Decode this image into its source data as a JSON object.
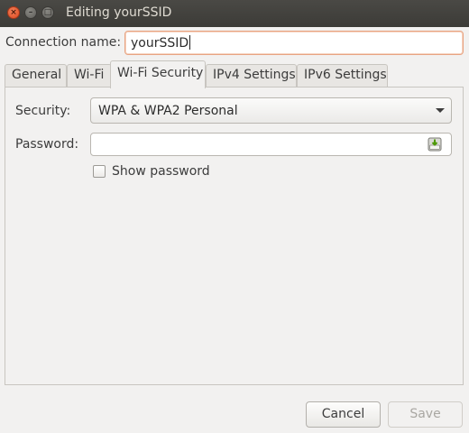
{
  "window": {
    "title": "Editing yourSSID",
    "close_glyph": "×",
    "min_glyph": "–",
    "max_glyph": "□"
  },
  "connection": {
    "label": "Connection name:",
    "value": "yourSSID"
  },
  "tabs": [
    {
      "label": "General",
      "active": false
    },
    {
      "label": "Wi-Fi",
      "active": false
    },
    {
      "label": "Wi-Fi Security",
      "active": true
    },
    {
      "label": "IPv4 Settings",
      "active": false
    },
    {
      "label": "IPv6 Settings",
      "active": false
    }
  ],
  "security": {
    "label": "Security:",
    "selected": "WPA & WPA2 Personal"
  },
  "password": {
    "label": "Password:",
    "value": "",
    "icon": "password-storage-icon"
  },
  "show_password": {
    "label": "Show password",
    "checked": false
  },
  "buttons": {
    "cancel": "Cancel",
    "save": "Save"
  },
  "colors": {
    "titlebar": "#3c3b37",
    "close": "#de4a1f",
    "focus_border": "#e8a482",
    "background": "#f2f1f0"
  }
}
